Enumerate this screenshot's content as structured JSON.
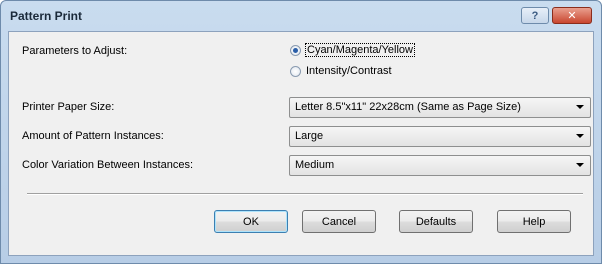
{
  "window": {
    "title": "Pattern Print",
    "help_label": "?",
    "close_label": "✕"
  },
  "params": {
    "label": "Parameters to Adjust:",
    "options": [
      {
        "label": "Cyan/Magenta/Yellow",
        "checked": true
      },
      {
        "label": "Intensity/Contrast",
        "checked": false
      }
    ]
  },
  "paper_size": {
    "label": "Printer Paper Size:",
    "value": "Letter 8.5\"x11\" 22x28cm (Same as Page Size)"
  },
  "pattern_amount": {
    "label": "Amount of Pattern Instances:",
    "value": "Large"
  },
  "color_variation": {
    "label": "Color Variation Between Instances:",
    "value": "Medium"
  },
  "buttons": {
    "ok": "OK",
    "cancel": "Cancel",
    "defaults": "Defaults",
    "help": "Help"
  }
}
